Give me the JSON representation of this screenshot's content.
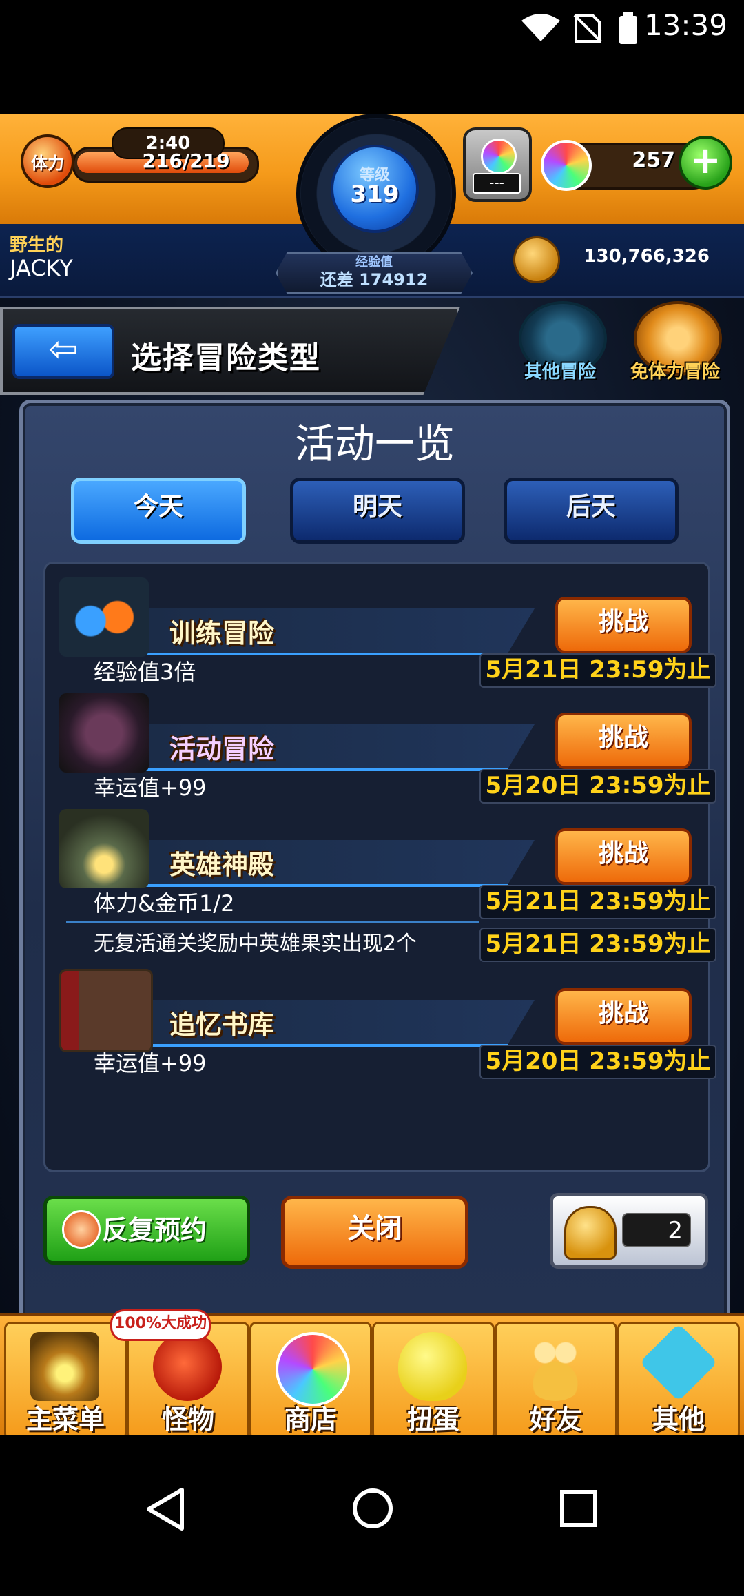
{
  "status_bar": {
    "time": "13:39"
  },
  "hud": {
    "stamina": {
      "label": "体力",
      "timer": "2:40",
      "value": "216/219",
      "fill_fraction": 0.986
    },
    "level": {
      "label": "等级",
      "value": "319"
    },
    "exp": {
      "label": "经验值",
      "remaining": "还差 174912"
    },
    "gacha": {
      "status": "---"
    },
    "orbs": {
      "count": "257",
      "add_label": "+"
    },
    "player": {
      "title": "野生的",
      "name": "JACKY"
    },
    "coins": {
      "count": "130,766,326"
    }
  },
  "header": {
    "title": "选择冒险类型",
    "back_label": "⇦",
    "other_adventure": "其他冒险",
    "free_stamina_adventure": "免体力冒险"
  },
  "modal": {
    "title": "活动一览",
    "tabs": [
      {
        "label": "今天",
        "active": true
      },
      {
        "label": "明天",
        "active": false
      },
      {
        "label": "后天",
        "active": false
      }
    ],
    "events": [
      {
        "name": "训练冒险",
        "challenge": "挑战",
        "desc": "经验值3倍",
        "deadline": "5月21日 23:59为止"
      },
      {
        "name": "活动冒险",
        "challenge": "挑战",
        "desc": "幸运值+99",
        "deadline": "5月20日 23:59为止"
      },
      {
        "name": "英雄神殿",
        "challenge": "挑战",
        "desc": "体力&金币1/2",
        "deadline": "5月21日 23:59为止",
        "desc2": "无复活通关奖励中英雄果实出现2个",
        "deadline2": "5月21日 23:59为止"
      },
      {
        "name": "追忆书库",
        "challenge": "挑战",
        "desc": "幸运值+99",
        "deadline": "5月20日 23:59为止"
      }
    ],
    "repeat_reserve": "反复预约",
    "close": "关闭",
    "bell_count": "2"
  },
  "bottom_menu": {
    "badge": "100%大成功",
    "items": [
      "主菜单",
      "怪物",
      "商店",
      "扭蛋",
      "好友",
      "其他"
    ]
  },
  "colors": {
    "accent_orange": "#f59a1a",
    "tab_active": "#0d6ae0",
    "deadline_yellow": "#ffd21a"
  }
}
